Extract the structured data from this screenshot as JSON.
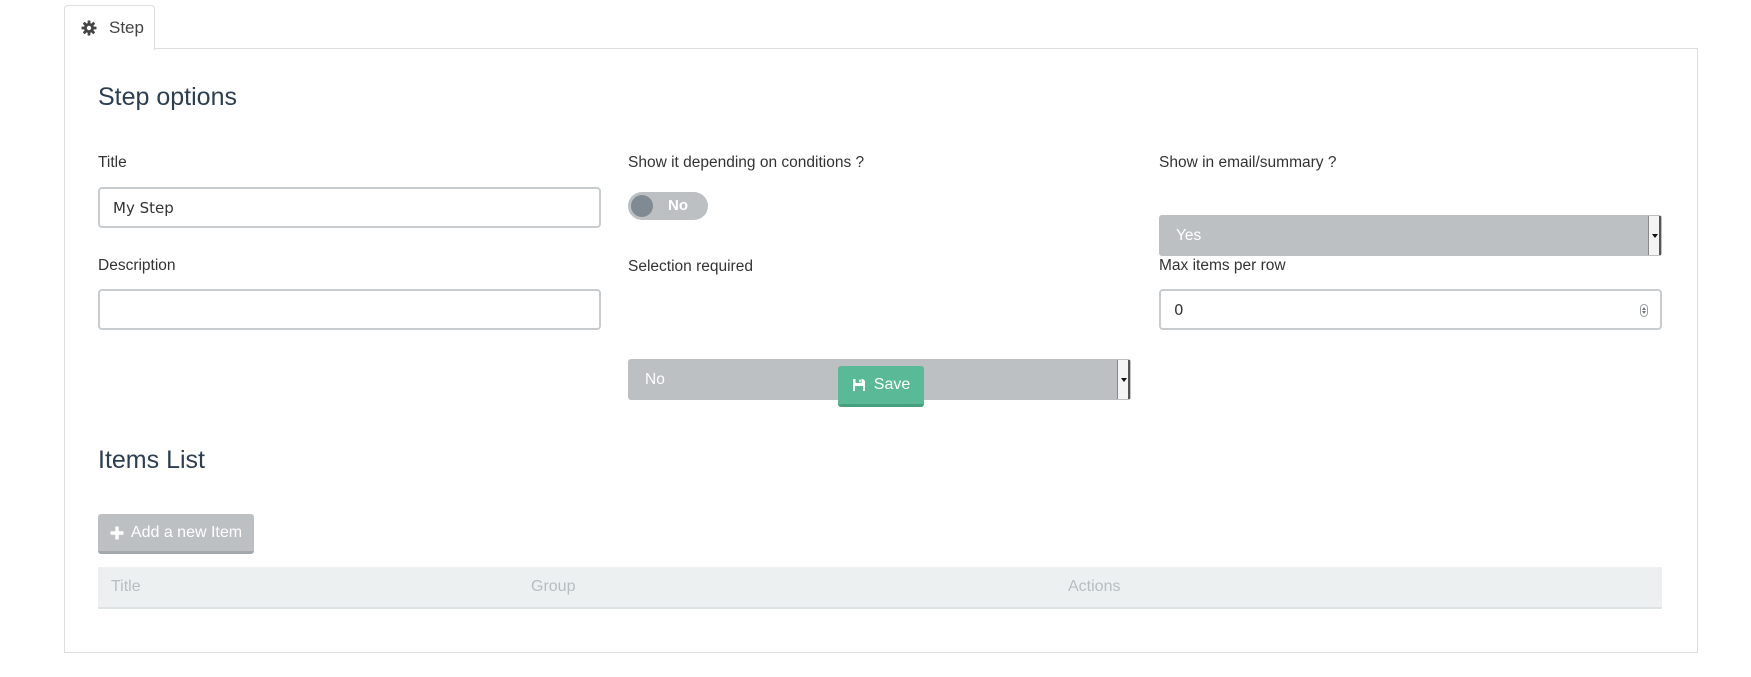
{
  "tab": {
    "label": "Step",
    "icon": "gear-icon"
  },
  "step_options": {
    "heading": "Step options",
    "title_label": "Title",
    "title_value": "My Step",
    "conditions_label": "Show it depending on conditions ?",
    "conditions_toggle": "No",
    "email_label": "Show in email/summary ?",
    "email_value": "Yes",
    "description_label": "Description",
    "description_value": "",
    "selection_label": "Selection required",
    "selection_value": "No",
    "max_items_label": "Max items per row",
    "max_items_value": "0",
    "save_label": "Save"
  },
  "items_list": {
    "heading": "Items List",
    "add_label": "Add a new Item",
    "columns": [
      "Title",
      "Group",
      "Actions"
    ]
  },
  "colors": {
    "primary_green": "#5ab996",
    "disabled_gray": "#bcc0c3",
    "heading_text": "#2c3e50",
    "table_header_bg": "#ecf0f1"
  }
}
